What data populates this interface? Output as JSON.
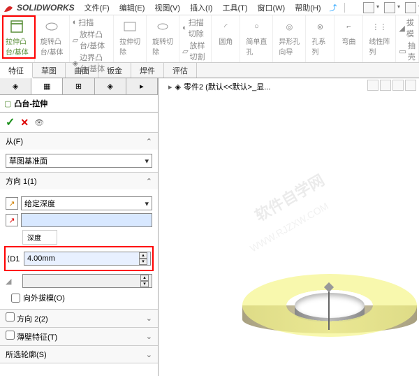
{
  "app": {
    "name": "SOLIDWORKS"
  },
  "menu": {
    "file": "文件(F)",
    "edit": "编辑(E)",
    "view": "视图(V)",
    "insert": "插入(I)",
    "tools": "工具(T)",
    "window": "窗口(W)",
    "help": "帮助(H)"
  },
  "ribbon": {
    "extrude": "拉伸凸\n台/基体",
    "revolve": "旋转凸\n台/基体",
    "sweep": "扫描",
    "loft": "放样凸台/基体",
    "boundary": "边界凸台/基体",
    "extrudeCut": "拉伸切\n除",
    "revolveCut": "旋转切\n除",
    "sweepCut": "扫描切除",
    "loftCut": "放样切割",
    "fillet": "圆角",
    "simpleHole": "简单直\n孔",
    "holeWizard": "异形孔\n向导",
    "holeSeries": "孔系列",
    "bend": "弯曲",
    "linearPattern": "线性阵\n列",
    "mirror": "拔模",
    "pullExit": "抽壳"
  },
  "tabs": {
    "feature": "特征",
    "sketch": "草图",
    "surface": "曲面",
    "sheetMetal": "钣金",
    "weldment": "焊件",
    "evaluate": "评估"
  },
  "feature": {
    "title": "凸台-拉伸",
    "from": {
      "label": "从(F)",
      "value": "草图基准面"
    },
    "dir1": {
      "label": "方向 1(1)",
      "endCondition": "给定深度",
      "depthLabel": "深度",
      "depth": "4.00mm",
      "draftOutward": "向外拔模(O)"
    },
    "dir2": {
      "label": "方向 2(2)"
    },
    "thin": {
      "label": "薄壁特征(T)"
    },
    "contour": {
      "label": "所选轮廓(S)"
    }
  },
  "breadcrumb": {
    "part": "零件2 (默认<<默认>_显..."
  },
  "watermark": {
    "line1": "软件自学网",
    "line2": "WWW.RJZXW.COM"
  }
}
